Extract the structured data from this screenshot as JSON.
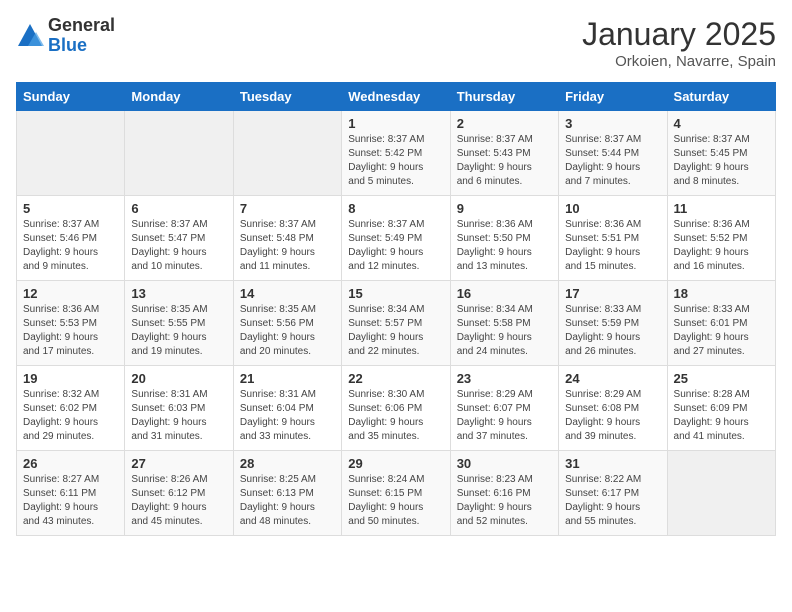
{
  "header": {
    "logo_general": "General",
    "logo_blue": "Blue",
    "title": "January 2025",
    "subtitle": "Orkoien, Navarre, Spain"
  },
  "days_of_week": [
    "Sunday",
    "Monday",
    "Tuesday",
    "Wednesday",
    "Thursday",
    "Friday",
    "Saturday"
  ],
  "weeks": [
    [
      {
        "day": "",
        "info": ""
      },
      {
        "day": "",
        "info": ""
      },
      {
        "day": "",
        "info": ""
      },
      {
        "day": "1",
        "info": "Sunrise: 8:37 AM\nSunset: 5:42 PM\nDaylight: 9 hours\nand 5 minutes."
      },
      {
        "day": "2",
        "info": "Sunrise: 8:37 AM\nSunset: 5:43 PM\nDaylight: 9 hours\nand 6 minutes."
      },
      {
        "day": "3",
        "info": "Sunrise: 8:37 AM\nSunset: 5:44 PM\nDaylight: 9 hours\nand 7 minutes."
      },
      {
        "day": "4",
        "info": "Sunrise: 8:37 AM\nSunset: 5:45 PM\nDaylight: 9 hours\nand 8 minutes."
      }
    ],
    [
      {
        "day": "5",
        "info": "Sunrise: 8:37 AM\nSunset: 5:46 PM\nDaylight: 9 hours\nand 9 minutes."
      },
      {
        "day": "6",
        "info": "Sunrise: 8:37 AM\nSunset: 5:47 PM\nDaylight: 9 hours\nand 10 minutes."
      },
      {
        "day": "7",
        "info": "Sunrise: 8:37 AM\nSunset: 5:48 PM\nDaylight: 9 hours\nand 11 minutes."
      },
      {
        "day": "8",
        "info": "Sunrise: 8:37 AM\nSunset: 5:49 PM\nDaylight: 9 hours\nand 12 minutes."
      },
      {
        "day": "9",
        "info": "Sunrise: 8:36 AM\nSunset: 5:50 PM\nDaylight: 9 hours\nand 13 minutes."
      },
      {
        "day": "10",
        "info": "Sunrise: 8:36 AM\nSunset: 5:51 PM\nDaylight: 9 hours\nand 15 minutes."
      },
      {
        "day": "11",
        "info": "Sunrise: 8:36 AM\nSunset: 5:52 PM\nDaylight: 9 hours\nand 16 minutes."
      }
    ],
    [
      {
        "day": "12",
        "info": "Sunrise: 8:36 AM\nSunset: 5:53 PM\nDaylight: 9 hours\nand 17 minutes."
      },
      {
        "day": "13",
        "info": "Sunrise: 8:35 AM\nSunset: 5:55 PM\nDaylight: 9 hours\nand 19 minutes."
      },
      {
        "day": "14",
        "info": "Sunrise: 8:35 AM\nSunset: 5:56 PM\nDaylight: 9 hours\nand 20 minutes."
      },
      {
        "day": "15",
        "info": "Sunrise: 8:34 AM\nSunset: 5:57 PM\nDaylight: 9 hours\nand 22 minutes."
      },
      {
        "day": "16",
        "info": "Sunrise: 8:34 AM\nSunset: 5:58 PM\nDaylight: 9 hours\nand 24 minutes."
      },
      {
        "day": "17",
        "info": "Sunrise: 8:33 AM\nSunset: 5:59 PM\nDaylight: 9 hours\nand 26 minutes."
      },
      {
        "day": "18",
        "info": "Sunrise: 8:33 AM\nSunset: 6:01 PM\nDaylight: 9 hours\nand 27 minutes."
      }
    ],
    [
      {
        "day": "19",
        "info": "Sunrise: 8:32 AM\nSunset: 6:02 PM\nDaylight: 9 hours\nand 29 minutes."
      },
      {
        "day": "20",
        "info": "Sunrise: 8:31 AM\nSunset: 6:03 PM\nDaylight: 9 hours\nand 31 minutes."
      },
      {
        "day": "21",
        "info": "Sunrise: 8:31 AM\nSunset: 6:04 PM\nDaylight: 9 hours\nand 33 minutes."
      },
      {
        "day": "22",
        "info": "Sunrise: 8:30 AM\nSunset: 6:06 PM\nDaylight: 9 hours\nand 35 minutes."
      },
      {
        "day": "23",
        "info": "Sunrise: 8:29 AM\nSunset: 6:07 PM\nDaylight: 9 hours\nand 37 minutes."
      },
      {
        "day": "24",
        "info": "Sunrise: 8:29 AM\nSunset: 6:08 PM\nDaylight: 9 hours\nand 39 minutes."
      },
      {
        "day": "25",
        "info": "Sunrise: 8:28 AM\nSunset: 6:09 PM\nDaylight: 9 hours\nand 41 minutes."
      }
    ],
    [
      {
        "day": "26",
        "info": "Sunrise: 8:27 AM\nSunset: 6:11 PM\nDaylight: 9 hours\nand 43 minutes."
      },
      {
        "day": "27",
        "info": "Sunrise: 8:26 AM\nSunset: 6:12 PM\nDaylight: 9 hours\nand 45 minutes."
      },
      {
        "day": "28",
        "info": "Sunrise: 8:25 AM\nSunset: 6:13 PM\nDaylight: 9 hours\nand 48 minutes."
      },
      {
        "day": "29",
        "info": "Sunrise: 8:24 AM\nSunset: 6:15 PM\nDaylight: 9 hours\nand 50 minutes."
      },
      {
        "day": "30",
        "info": "Sunrise: 8:23 AM\nSunset: 6:16 PM\nDaylight: 9 hours\nand 52 minutes."
      },
      {
        "day": "31",
        "info": "Sunrise: 8:22 AM\nSunset: 6:17 PM\nDaylight: 9 hours\nand 55 minutes."
      },
      {
        "day": "",
        "info": ""
      }
    ]
  ]
}
